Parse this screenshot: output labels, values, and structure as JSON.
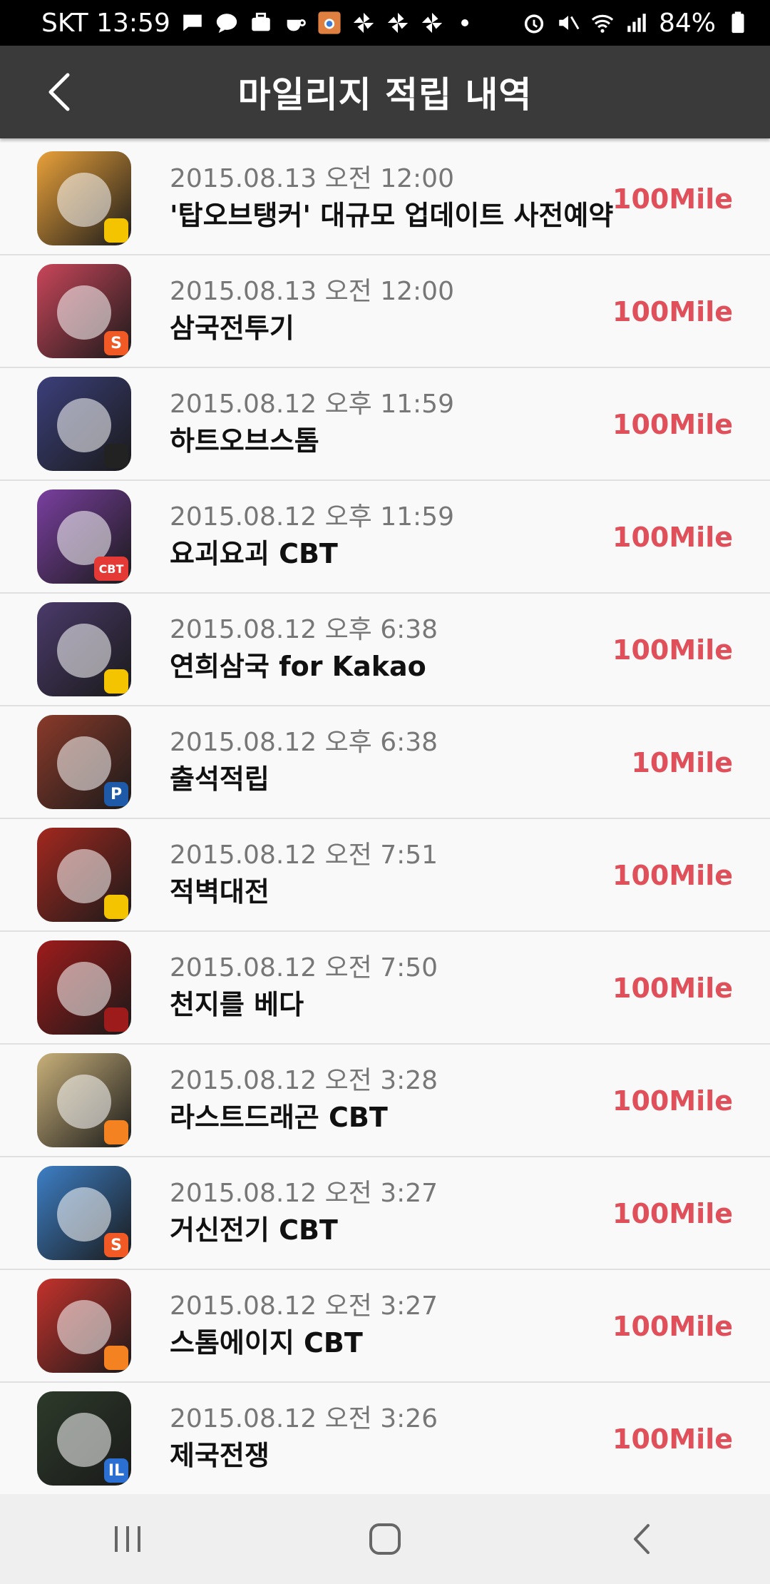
{
  "status_bar": {
    "carrier_time": "SKT 13:59",
    "battery": "84%",
    "icons_left": [
      "message-icon",
      "talk-icon",
      "briefcase-icon",
      "cup-icon",
      "camera-icon",
      "pinwheel-icon",
      "pinwheel-icon",
      "pinwheel-icon"
    ],
    "icons_right": [
      "alarm-icon",
      "mute-icon",
      "wifi-icon",
      "signal-icon",
      "battery-icon"
    ]
  },
  "header": {
    "title": "마일리지 적립 내역",
    "back_icon": "chevron-left-icon"
  },
  "colors": {
    "mile": "#e0505a",
    "appbar": "#3a3a3a"
  },
  "items": [
    {
      "date": "2015.08.13 오전 12:00",
      "name": "'탑오브탱커' 대규모 업데이트 사전예약",
      "mile": "100Mile",
      "color": "#e9a13a",
      "badge": "",
      "badge_color": "#f5c400"
    },
    {
      "date": "2015.08.13 오전 12:00",
      "name": "삼국전투기",
      "mile": "100Mile",
      "color": "#c9465a",
      "badge": "S",
      "badge_color": "#f15a24"
    },
    {
      "date": "2015.08.12 오후 11:59",
      "name": "하트오브스톰",
      "mile": "100Mile",
      "color": "#3b3f7a",
      "badge": "",
      "badge_color": "#222222"
    },
    {
      "date": "2015.08.12 오후 11:59",
      "name": "요괴요괴 CBT",
      "mile": "100Mile",
      "color": "#7a3fa0",
      "badge": "CBT",
      "badge_color": "#e53935"
    },
    {
      "date": "2015.08.12 오후 6:38",
      "name": "연희삼국 for Kakao",
      "mile": "100Mile",
      "color": "#4a3a6a",
      "badge": "",
      "badge_color": "#f5c400"
    },
    {
      "date": "2015.08.12 오후 6:38",
      "name": "출석적립",
      "mile": "10Mile",
      "color": "#8a3a2a",
      "badge": "P",
      "badge_color": "#1e5aa8"
    },
    {
      "date": "2015.08.12 오전 7:51",
      "name": "적벽대전",
      "mile": "100Mile",
      "color": "#a3281f",
      "badge": "",
      "badge_color": "#f5c400"
    },
    {
      "date": "2015.08.12 오전 7:50",
      "name": "천지를 베다",
      "mile": "100Mile",
      "color": "#9e1b1b",
      "badge": "",
      "badge_color": "#9e1b1b"
    },
    {
      "date": "2015.08.12 오전 3:28",
      "name": "라스트드래곤 CBT",
      "mile": "100Mile",
      "color": "#c8b07a",
      "badge": "",
      "badge_color": "#f58220"
    },
    {
      "date": "2015.08.12 오전 3:27",
      "name": "거신전기 CBT",
      "mile": "100Mile",
      "color": "#3d7fc6",
      "badge": "S",
      "badge_color": "#f15a24"
    },
    {
      "date": "2015.08.12 오전 3:27",
      "name": "스톰에이지 CBT",
      "mile": "100Mile",
      "color": "#c4322c",
      "badge": "",
      "badge_color": "#f58220"
    },
    {
      "date": "2015.08.12 오전 3:26",
      "name": "제국전쟁",
      "mile": "100Mile",
      "color": "#2d3a2a",
      "badge": "IL",
      "badge_color": "#2a6fd1"
    }
  ],
  "navbar": {
    "recent_icon": "recent-apps-icon",
    "home_icon": "home-icon",
    "back_icon": "back-icon"
  }
}
